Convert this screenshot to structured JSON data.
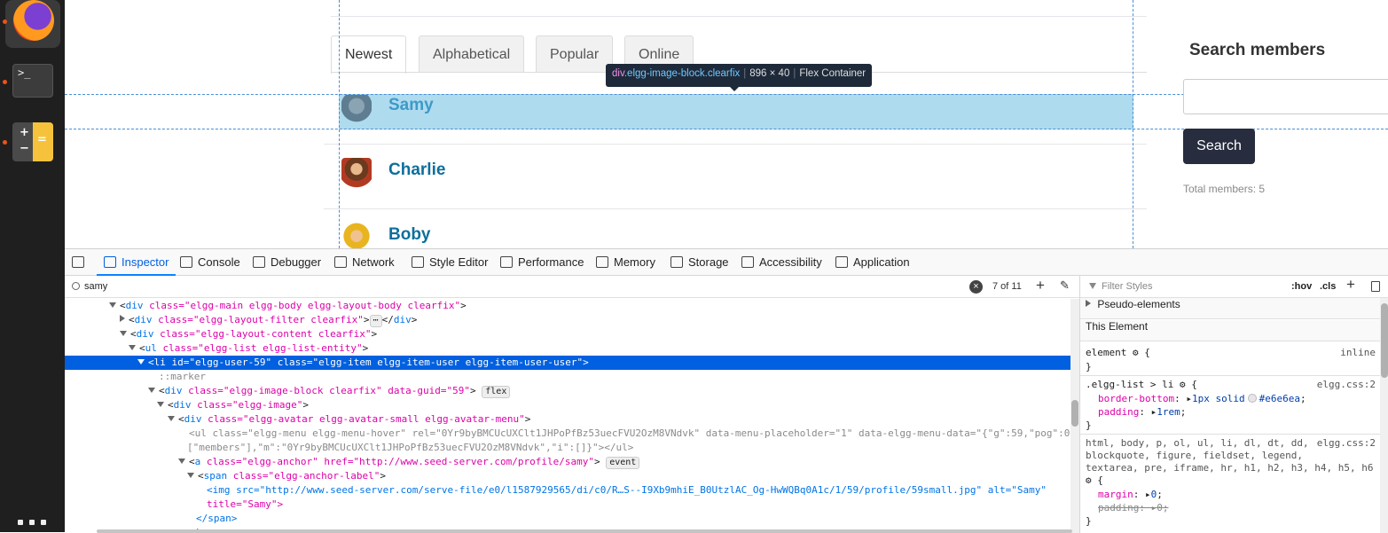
{
  "dock": {
    "apps": [
      {
        "name": "Firefox"
      },
      {
        "name": "Terminal",
        "glyph": ">_"
      },
      {
        "name": "Calculator"
      }
    ]
  },
  "page": {
    "tabs": [
      "Newest",
      "Alphabetical",
      "Popular",
      "Online"
    ],
    "selected_tab": "Newest",
    "members": [
      "Samy",
      "Charlie",
      "Boby"
    ],
    "tooltip": {
      "tag": "div",
      "classes": ".elgg-image-block.clearfix",
      "size": "896 × 40",
      "kind": "Flex Container"
    },
    "sidebar": {
      "title": "Search members",
      "button": "Search",
      "total": "Total members: 5"
    }
  },
  "devtools": {
    "tabs": [
      "Inspector",
      "Console",
      "Debugger",
      "Network",
      "Style Editor",
      "Performance",
      "Memory",
      "Storage",
      "Accessibility",
      "Application"
    ],
    "selected_tab": "Inspector",
    "search": {
      "query": "samy",
      "count": "7 of 11"
    },
    "markup": [
      {
        "tag": "div",
        "attrs": "class=\"elgg-main elgg-body elgg-layout-body clearfix\""
      },
      {
        "tag": "div",
        "attrs": "class=\"elgg-layout-filter clearfix\"",
        "collapsed": true
      },
      {
        "tag": "div",
        "attrs": "class=\"elgg-layout-content clearfix\""
      },
      {
        "tag": "ul",
        "attrs": "class=\"elgg-list elgg-list-entity\""
      },
      {
        "tag": "li",
        "attrs": "id=\"elgg-user-59\" class=\"elgg-item elgg-item-user elgg-item-user-user\"",
        "selected": true
      },
      {
        "pseudo": "::marker"
      },
      {
        "tag": "div",
        "attrs": "class=\"elgg-image-block clearfix\" data-guid=\"59\"",
        "badge": "flex"
      },
      {
        "tag": "div",
        "attrs": "class=\"elgg-image\""
      },
      {
        "tag": "div",
        "attrs": "class=\"elgg-avatar elgg-avatar-small elgg-avatar-menu\""
      },
      {
        "raw": "<ul class=\"elgg-menu elgg-menu-hover\" rel=\"0Yr9byBMCUcUXClt1JHPoPfBz53uecFVU2OzM8VNdvk\" data-menu-placeholder=\"1\" data-elgg-menu-data=\"{\"g\":59,\"pog\":0,"
      },
      {
        "raw": "[\"members\"],\"m\":\"0Yr9byBMCUcUXClt1JHPoPfBz53uecFVU2OzM8VNdvk\",\"i\":[]}\"></ul>"
      },
      {
        "tag": "a",
        "attrs": "class=\"elgg-anchor\" href=\"http://www.seed-server.com/profile/samy\"",
        "badge": "event"
      },
      {
        "tag": "span",
        "attrs": "class=\"elgg-anchor-label\""
      },
      {
        "raw": "<img src=\"http://www.seed-server.com/serve-file/e0/l1587929565/di/c0/R…S--I9Xb9mhiE_B0UtzlAC_Og-HwWQBq0A1c/1/59/profile/59small.jpg\" alt=\"Samy\""
      },
      {
        "raw": "title=\"Samy\">"
      },
      {
        "raw": "</span>"
      },
      {
        "raw": "</a>"
      }
    ],
    "rules": {
      "filter_placeholder": "Filter Styles",
      "hov": ":hov",
      "cls": ".cls",
      "pseudo_elements": "Pseudo-elements",
      "this_element": "This Element",
      "element_rule": "element",
      "element_source": "inline",
      "list_selector": ".elgg-list > li",
      "list_source": "elgg.css:2",
      "border_prop": "border-bottom",
      "border_val": "1px solid",
      "border_color": "#e6e6ea",
      "padding_prop": "padding",
      "padding_val": "1rem",
      "reset_selector_1": "html, body, p, ol, ul, li, dl, dt, dd,",
      "reset_selector_2": "blockquote, figure, fieldset, legend,",
      "reset_selector_3": "textarea, pre, iframe, hr, h1, h2, h3, h4, h5, h6",
      "reset_source": "elgg.css:2",
      "margin_prop": "margin",
      "margin_val": "0",
      "padding2_prop": "padding",
      "padding2_val": "0"
    }
  }
}
